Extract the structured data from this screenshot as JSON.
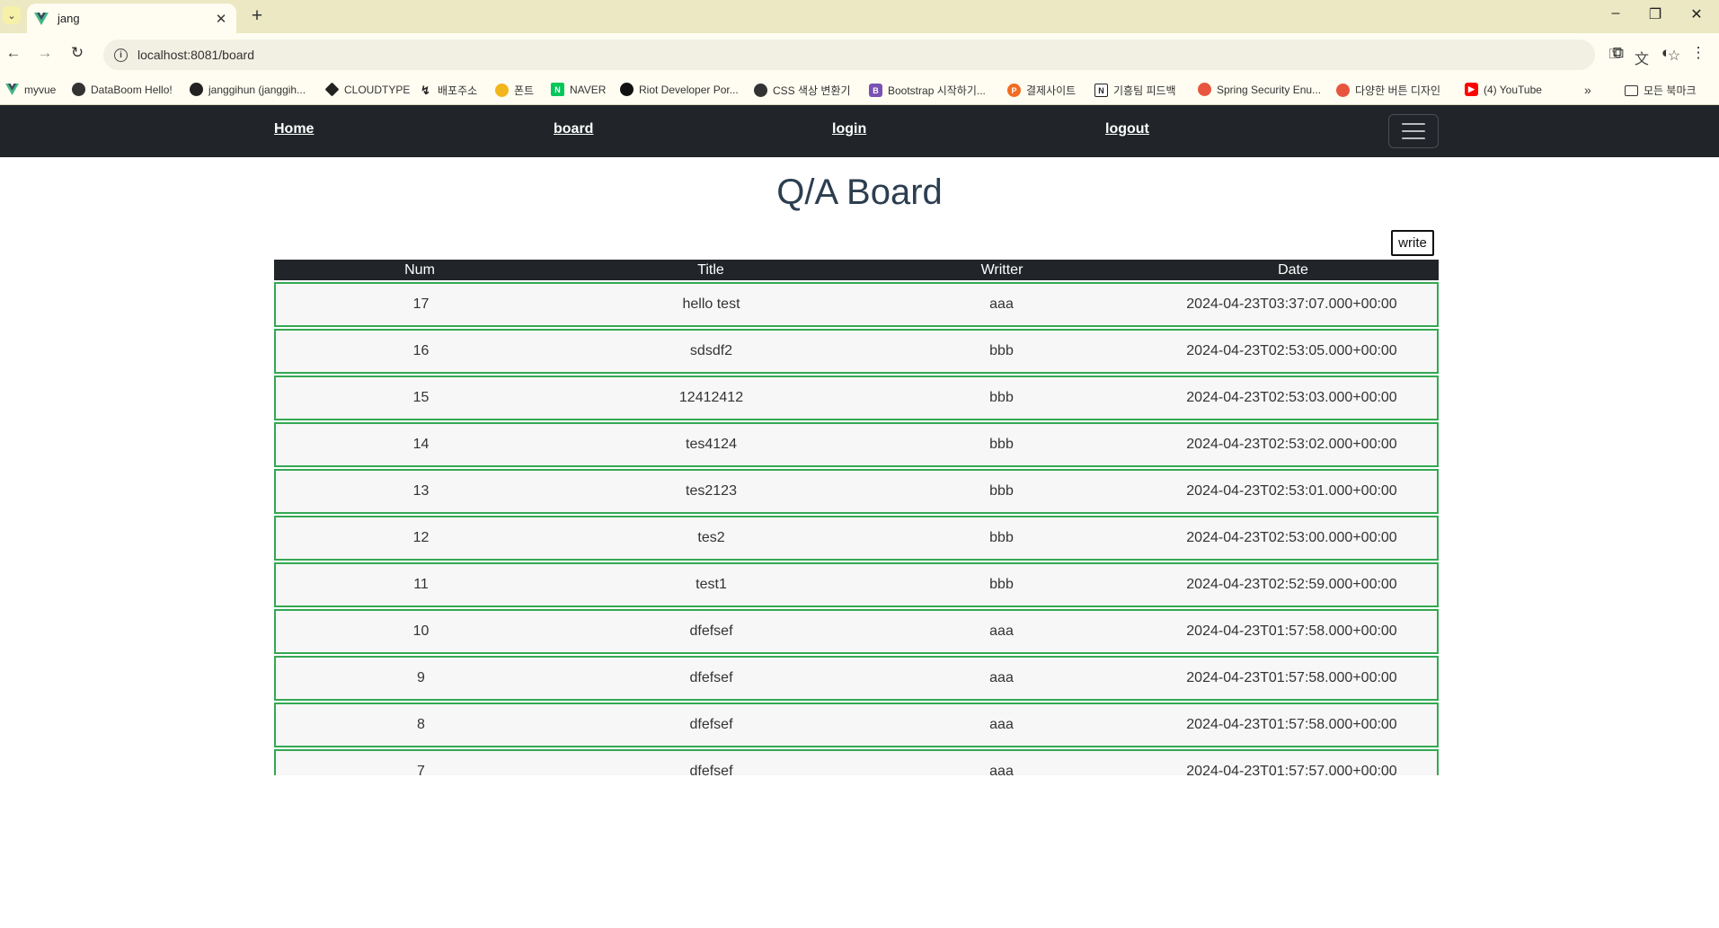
{
  "browser": {
    "tab_title": "jang",
    "url": "localhost:8081/board",
    "bookmarks": [
      {
        "label": "myvue",
        "icon": "vue-icon",
        "color": "#42b883"
      },
      {
        "label": "DataBoom Hello!",
        "icon": "globe-icon",
        "color": "#333333"
      },
      {
        "label": "janggihun (janggih...",
        "icon": "github-icon",
        "color": "#222222"
      },
      {
        "label": "CLOUDTYPE",
        "icon": "cloudtype-icon",
        "color": "#222222"
      },
      {
        "label": "배포주소",
        "icon": "deploy-icon",
        "color": "#222222"
      },
      {
        "label": "폰트",
        "icon": "font-icon",
        "color": "#f2b51d"
      },
      {
        "label": "NAVER",
        "icon": "naver-icon",
        "color": "#03c75a"
      },
      {
        "label": "Riot Developer Por...",
        "icon": "riot-icon",
        "color": "#111111"
      },
      {
        "label": "CSS 색상 변환기",
        "icon": "globe-icon",
        "color": "#333333"
      },
      {
        "label": "Bootstrap 시작하기...",
        "icon": "bootstrap-icon",
        "color": "#7952b3"
      },
      {
        "label": "결제사이트",
        "icon": "payment-icon",
        "color": "#f26b21"
      },
      {
        "label": "기흥팀 피드백",
        "icon": "notion-icon",
        "color": "#222222"
      },
      {
        "label": "Spring Security Enu...",
        "icon": "spring-icon",
        "color": "#e8553f"
      },
      {
        "label": "다양한 버튼 디자인",
        "icon": "button-design-icon",
        "color": "#e8553f"
      },
      {
        "label": "(4) YouTube",
        "icon": "youtube-icon",
        "color": "#ff0000"
      }
    ],
    "all_bookmarks": "모든 북마크"
  },
  "nav": {
    "home": "Home",
    "board": "board",
    "login": "login",
    "logout": "logout"
  },
  "page": {
    "title": "Q/A Board",
    "write_label": "write"
  },
  "table": {
    "headers": {
      "num": "Num",
      "title": "Title",
      "writer": "Writter",
      "date": "Date"
    },
    "rows": [
      {
        "num": "17",
        "title": "hello test",
        "writer": "aaa",
        "date": "2024-04-23T03:37:07.000+00:00"
      },
      {
        "num": "16",
        "title": "sdsdf2",
        "writer": "bbb",
        "date": "2024-04-23T02:53:05.000+00:00"
      },
      {
        "num": "15",
        "title": "12412412",
        "writer": "bbb",
        "date": "2024-04-23T02:53:03.000+00:00"
      },
      {
        "num": "14",
        "title": "tes4124",
        "writer": "bbb",
        "date": "2024-04-23T02:53:02.000+00:00"
      },
      {
        "num": "13",
        "title": "tes2123",
        "writer": "bbb",
        "date": "2024-04-23T02:53:01.000+00:00"
      },
      {
        "num": "12",
        "title": "tes2",
        "writer": "bbb",
        "date": "2024-04-23T02:53:00.000+00:00"
      },
      {
        "num": "11",
        "title": "test1",
        "writer": "bbb",
        "date": "2024-04-23T02:52:59.000+00:00"
      },
      {
        "num": "10",
        "title": "dfefsef",
        "writer": "aaa",
        "date": "2024-04-23T01:57:58.000+00:00"
      },
      {
        "num": "9",
        "title": "dfefsef",
        "writer": "aaa",
        "date": "2024-04-23T01:57:58.000+00:00"
      },
      {
        "num": "8",
        "title": "dfefsef",
        "writer": "aaa",
        "date": "2024-04-23T01:57:58.000+00:00"
      },
      {
        "num": "7",
        "title": "dfefsef",
        "writer": "aaa",
        "date": "2024-04-23T01:57:57.000+00:00"
      }
    ]
  },
  "colors": {
    "navbar": "#212529",
    "row_border": "#34a853",
    "title": "#2c3e50"
  }
}
